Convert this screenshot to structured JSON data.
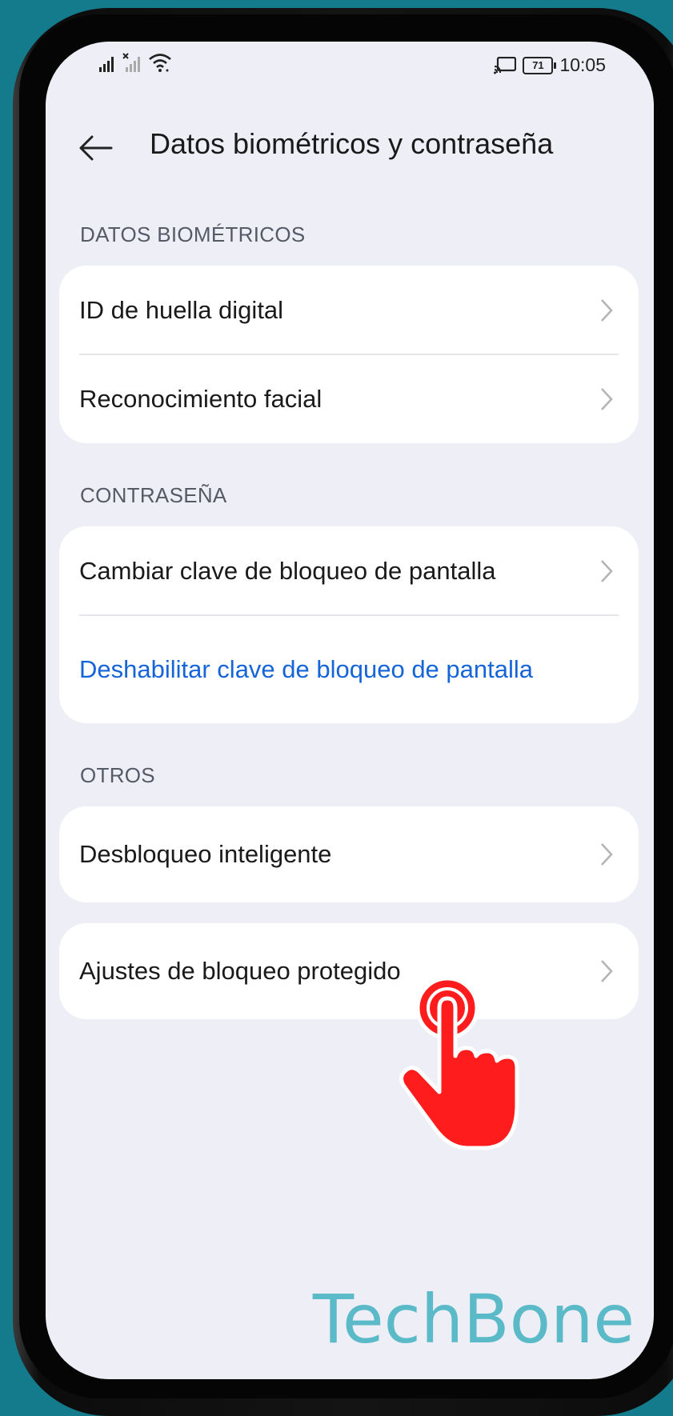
{
  "statusbar": {
    "time": "10:05",
    "battery": "71"
  },
  "header": {
    "title": "Datos biométricos y contraseña"
  },
  "sections": {
    "biometrics": {
      "label": "DATOS BIOMÉTRICOS",
      "items": [
        "ID de huella digital",
        "Reconocimiento facial"
      ]
    },
    "password": {
      "label": "CONTRASEÑA",
      "change": "Cambiar clave de bloqueo de pantalla",
      "disable": "Deshabilitar clave de bloqueo de pantalla"
    },
    "others": {
      "label": "OTROS",
      "smart_unlock": "Desbloqueo inteligente",
      "protected_lock": "Ajustes de bloqueo protegido"
    }
  },
  "watermark": "TechBone",
  "colors": {
    "background": "#137b8c",
    "screen": "#eeeef6",
    "link": "#1565d8",
    "watermark": "#5bbac8",
    "tap_hand": "#ff1c1c"
  },
  "icons": [
    "signal-icon",
    "wifi-icon",
    "cast-icon",
    "battery-icon",
    "back-arrow-icon",
    "chevron-right-icon",
    "tap-hand-icon"
  ]
}
